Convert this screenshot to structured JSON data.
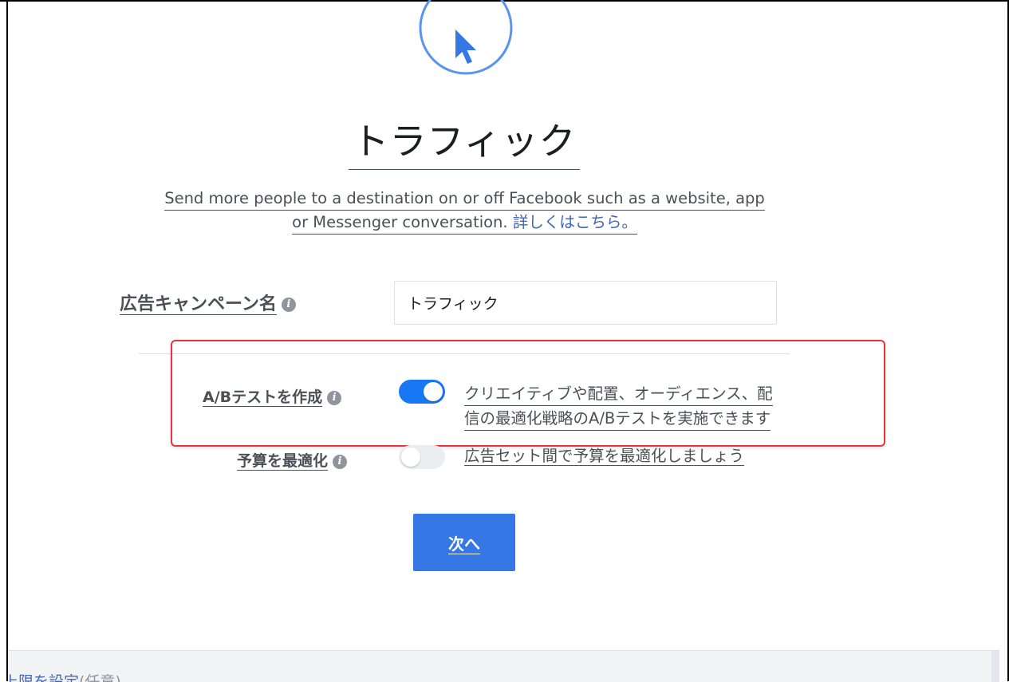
{
  "objective": {
    "icon": "cursor-icon",
    "title": "トラフィック",
    "description_line1": "Send more people to a destination on or off Facebook such as a website, app",
    "description_line2": "or Messenger conversation.",
    "learn_more": "詳しくはこちら。"
  },
  "campaign_name": {
    "label": "広告キャンペーン名",
    "value": "トラフィック"
  },
  "ab_test": {
    "label": "A/Bテストを作成",
    "enabled": true,
    "description_line1": "クリエイティブや配置、オーディエンス、配",
    "description_line2": "信の最適化戦略のA/Bテストを実施できます"
  },
  "budget_optimization": {
    "label": "予算を最適化",
    "enabled": false,
    "description": "広告セット間で予算を最適化しましょう"
  },
  "actions": {
    "next_label": "次へ"
  },
  "footer": {
    "link_text": "上限を設定",
    "suffix": "(任意)"
  },
  "colors": {
    "accent": "#3578e5",
    "highlight": "#e8343f",
    "icon_ring": "#5b93f0"
  }
}
